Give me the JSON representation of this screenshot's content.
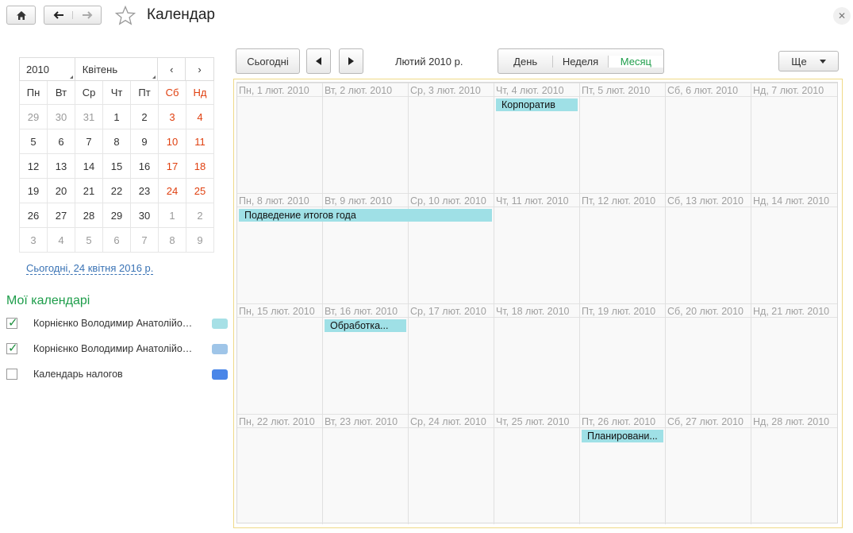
{
  "header": {
    "title": "Календар"
  },
  "mini_calendar": {
    "year": "2010",
    "month": "Квітень",
    "prev": "‹",
    "next": "›",
    "weekdays": [
      "Пн",
      "Вт",
      "Ср",
      "Чт",
      "Пт",
      "Сб",
      "Нд"
    ],
    "weeks": [
      [
        "29",
        "30",
        "31",
        "1",
        "2",
        "3",
        "4"
      ],
      [
        "5",
        "6",
        "7",
        "8",
        "9",
        "10",
        "11"
      ],
      [
        "12",
        "13",
        "14",
        "15",
        "16",
        "17",
        "18"
      ],
      [
        "19",
        "20",
        "21",
        "22",
        "23",
        "24",
        "25"
      ],
      [
        "26",
        "27",
        "28",
        "29",
        "30",
        "1",
        "2"
      ],
      [
        "3",
        "4",
        "5",
        "6",
        "7",
        "8",
        "9"
      ]
    ],
    "today_link": "Сьогодні, 24 квітня 2016 р."
  },
  "my_calendars": {
    "title": "Мої календарі",
    "items": [
      {
        "name": "Корнієнко Володимир Анатолійович",
        "checked": true,
        "color": "#a6e0e6"
      },
      {
        "name": "Корнієнко Володимир Анатолійович",
        "checked": true,
        "color": "#9fc5e8"
      },
      {
        "name": "Календарь налогов",
        "checked": false,
        "color": "#4a86e8"
      }
    ]
  },
  "toolbar": {
    "today": "Сьогодні",
    "period": "Лютий 2010 р.",
    "views": [
      "День",
      "Неделя",
      "Месяц"
    ],
    "active_view": "Месяц",
    "more": "Ще"
  },
  "month": {
    "weeks": [
      [
        "Пн, 1 лют. 2010",
        "Вт, 2 лют. 2010",
        "Ср, 3 лют. 2010",
        "Чт, 4 лют. 2010",
        "Пт, 5 лют. 2010",
        "Сб, 6 лют. 2010",
        "Нд, 7 лют. 2010"
      ],
      [
        "Пн, 8 лют. 2010",
        "Вт, 9 лют. 2010",
        "Ср, 10 лют. 2010",
        "Чт, 11 лют. 2010",
        "Пт, 12 лют. 2010",
        "Сб, 13 лют. 2010",
        "Нд, 14 лют. 2010"
      ],
      [
        "Пн, 15 лют. 2010",
        "Вт, 16 лют. 2010",
        "Ср, 17 лют. 2010",
        "Чт, 18 лют. 2010",
        "Пт, 19 лют. 2010",
        "Сб, 20 лют. 2010",
        "Нд, 21 лют. 2010"
      ],
      [
        "Пн, 22 лют. 2010",
        "Вт, 23 лют. 2010",
        "Ср, 24 лют. 2010",
        "Чт, 25 лют. 2010",
        "Пт, 26 лют. 2010",
        "Сб, 27 лют. 2010",
        "Нд, 28 лют. 2010"
      ]
    ],
    "events": [
      {
        "title": "Корпоратив",
        "date": "Чт, 4 лют. 2010",
        "end": "Чт, 4 лют. 2010"
      },
      {
        "title": "Подведение итогов года",
        "date": "Пн, 8 лют. 2010",
        "end": "Ср, 10 лют. 2010"
      },
      {
        "title": "Обработка...",
        "date": "Вт, 16 лют. 2010",
        "end": "Вт, 16 лют. 2010"
      },
      {
        "title": "Планировани...",
        "date": "Пт, 26 лют. 2010",
        "end": "Пт, 26 лют. 2010"
      }
    ]
  }
}
